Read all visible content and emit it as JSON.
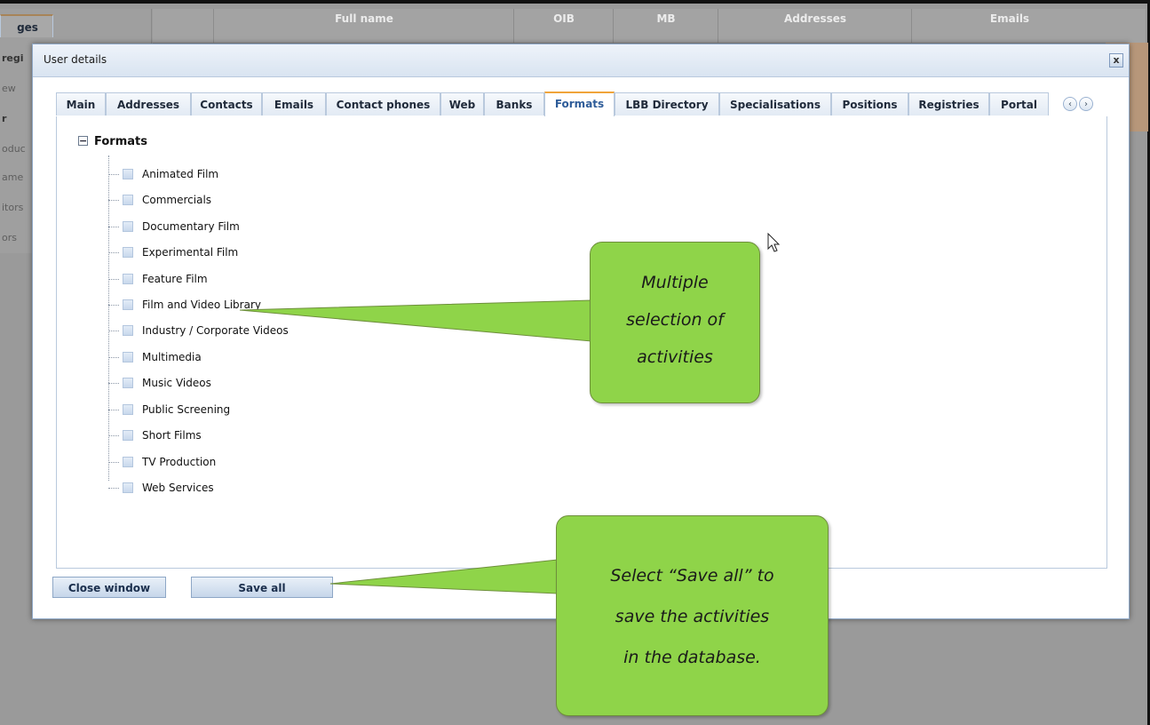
{
  "background": {
    "sidebar_items": [
      "ges",
      "regi",
      "ew",
      "r",
      "oduc",
      "ame",
      "itors",
      "ors"
    ],
    "grid_columns": [
      "Full name",
      "OIB",
      "MB",
      "Addresses",
      "Emails"
    ]
  },
  "modal": {
    "title": "User details",
    "close_label": "x",
    "tabs": [
      {
        "label": "Main"
      },
      {
        "label": "Addresses"
      },
      {
        "label": "Contacts"
      },
      {
        "label": "Emails"
      },
      {
        "label": "Contact phones"
      },
      {
        "label": "Web"
      },
      {
        "label": "Banks"
      },
      {
        "label": "Formats"
      },
      {
        "label": "LBB Directory"
      },
      {
        "label": "Specialisations"
      },
      {
        "label": "Positions"
      },
      {
        "label": "Registries"
      },
      {
        "label": "Portal"
      }
    ],
    "active_tab": "Formats",
    "tab_scroll_left": "‹",
    "tab_scroll_right": "›",
    "tree": {
      "toggle": "−",
      "root_label": "Formats",
      "items": [
        "Animated Film",
        "Commercials",
        "Documentary Film",
        "Experimental Film",
        "Feature Film",
        "Film and Video Library",
        "Industry / Corporate Videos",
        "Multimedia",
        "Music Videos",
        "Public Screening",
        "Short Films",
        "TV Production",
        "Web Services"
      ]
    },
    "buttons": {
      "close_window": "Close window",
      "save_all": "Save all"
    }
  },
  "callouts": {
    "multiple_selection": [
      "Multiple",
      "selection of",
      "activities"
    ],
    "save_all": [
      "Select “Save all” to",
      "save the activities",
      "in the database."
    ],
    "fill_color": "#8fd449"
  }
}
